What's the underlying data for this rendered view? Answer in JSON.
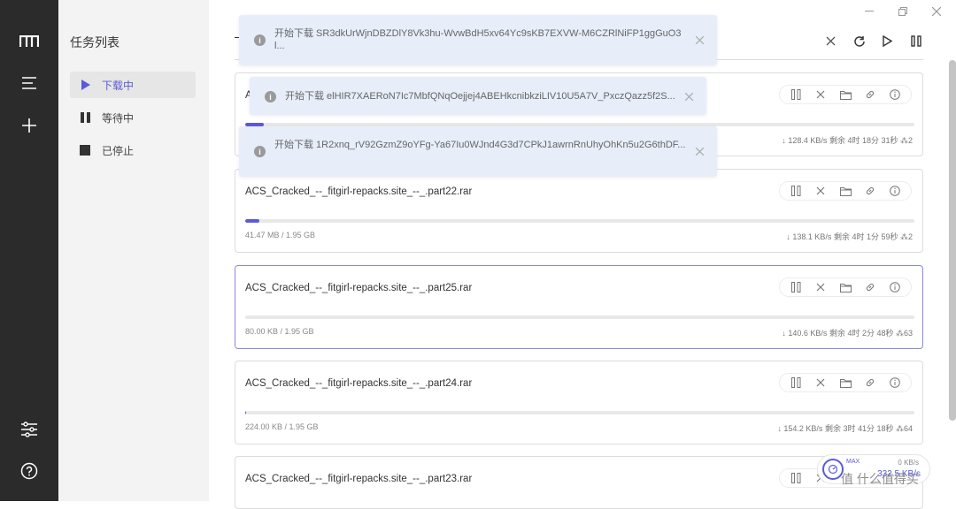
{
  "rail": {
    "logo": "motrix-logo-icon",
    "items": [
      "menu-icon",
      "add-icon"
    ],
    "bottom": [
      "preferences-icon",
      "help-icon"
    ]
  },
  "sidebar": {
    "title": "任务列表",
    "items": [
      {
        "label": "下载中",
        "icon": "play-icon",
        "active": true
      },
      {
        "label": "等待中",
        "icon": "pause-icon",
        "active": false
      },
      {
        "label": "已停止",
        "icon": "stop-icon",
        "active": false
      }
    ]
  },
  "toolbar": [
    "close-icon",
    "refresh-icon",
    "resume-all-icon",
    "pause-all-icon"
  ],
  "tasks": [
    {
      "name": "A",
      "size": "",
      "speed": "↓ 128.4 KB/s",
      "remaining": "剩余 4时 18分 31秒",
      "connections": "⁂2",
      "progress": 0.028,
      "selected": false
    },
    {
      "name": "ACS_Cracked_--_fitgirl-repacks.site_--_.part22.rar",
      "size": "41.47 MB / 1.95 GB",
      "speed": "↓ 138.1 KB/s",
      "remaining": "剩余 4时 1分 59秒",
      "connections": "⁂2",
      "progress": 0.021,
      "selected": false
    },
    {
      "name": "ACS_Cracked_--_fitgirl-repacks.site_--_.part25.rar",
      "size": "80.00 KB / 1.95 GB",
      "speed": "↓ 140.6 KB/s",
      "remaining": "剩余 4时 2分 48秒",
      "connections": "⁂63",
      "progress": 0.0,
      "selected": true
    },
    {
      "name": "ACS_Cracked_--_fitgirl-repacks.site_--_.part24.rar",
      "size": "224.00 KB / 1.95 GB",
      "speed": "↓ 154.2 KB/s",
      "remaining": "剩余 3时 41分 18秒",
      "connections": "⁂64",
      "progress": 0.001,
      "selected": false
    },
    {
      "name": "ACS_Cracked_--_fitgirl-repacks.site_--_.part23.rar",
      "size": "",
      "speed": "",
      "remaining": "",
      "connections": "",
      "progress": 0.0,
      "selected": false
    }
  ],
  "toasts": [
    {
      "text": "开始下载 SR3dkUrWjnDBZDlY8Vk3hu-WvwBdH5xv64Yc9sKB7EXVW-M6CZRlNiFP1ggGuO3l..."
    },
    {
      "text": "开始下载 elHIR7XAERoN7Ic7MbfQNqOejjej4ABEHkcnibkziLIV10U5A7V_PxczQazz5f2S..."
    },
    {
      "text": "开始下载 1R2xnq_rV92GzmZ9oYFg-Ya67Iu0WJnd4G3d7CPkJ1awrnRnUhyOhKn5u2G6thDF..."
    }
  ],
  "speedometer": {
    "max_label": "MAX",
    "upload": "0 KB/s",
    "download": "332.5 KB/s"
  },
  "watermark": "值 什么值得买",
  "colors": {
    "accent": "#5b5bd6",
    "rail": "#2b2b2b",
    "sidebar": "#f3f3f3",
    "toast": "#e7edf9"
  }
}
